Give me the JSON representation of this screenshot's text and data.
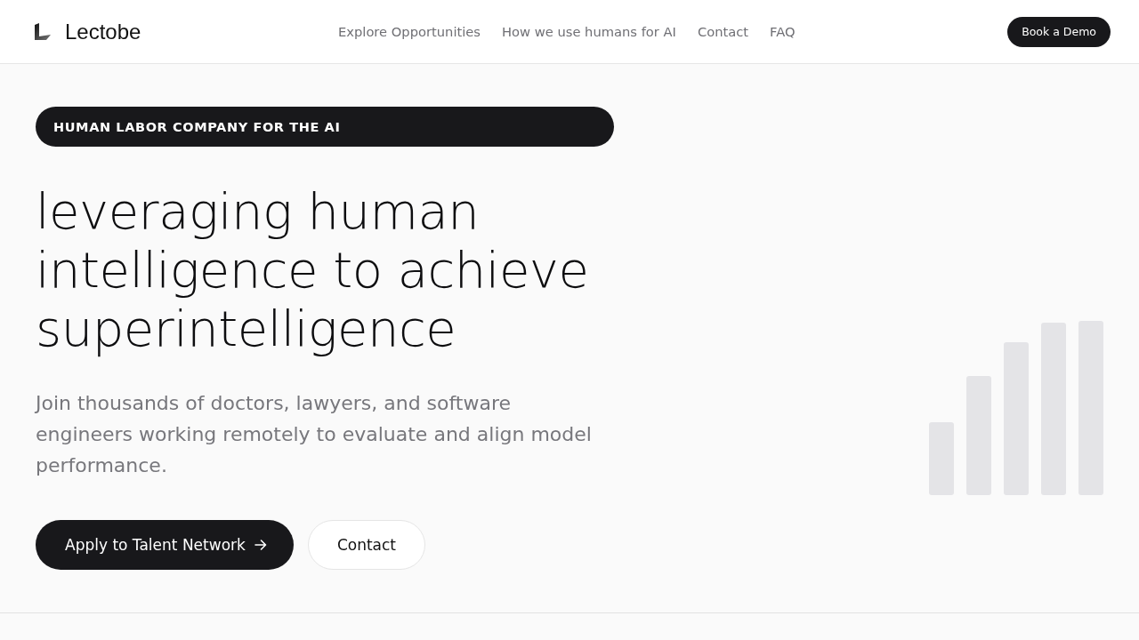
{
  "header": {
    "brand": "Lectobe",
    "nav": [
      {
        "label": "Explore Opportunities"
      },
      {
        "label": "How we use humans for AI"
      },
      {
        "label": "Contact"
      },
      {
        "label": "FAQ"
      }
    ],
    "cta": "Book a Demo"
  },
  "hero": {
    "badge": "HUMAN LABOR COMPANY FOR THE AI",
    "headline": "leveraging human intelligence to achieve superintelligence",
    "description": "Join thousands of doctors, lawyers, and software engineers working remotely to evaluate and align model performance.",
    "buttons": [
      {
        "kind": "primary",
        "label": "Apply to Talent Network"
      },
      {
        "kind": "secondary",
        "label": "Contact"
      }
    ]
  }
}
